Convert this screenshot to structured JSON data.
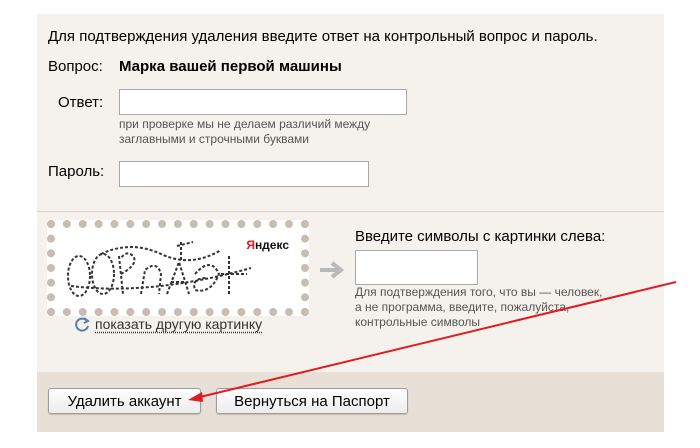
{
  "intro": "Для подтверждения удаления введите ответ на контрольный вопрос и пароль.",
  "question": {
    "label": "Вопрос:",
    "text": "Марка вашей первой машины"
  },
  "answer": {
    "label": "Ответ:",
    "value": "",
    "hint_line1": "при проверке мы не делаем различий между",
    "hint_line2": "заглавными и строчными буквами"
  },
  "password": {
    "label": "Пароль:",
    "value": ""
  },
  "captcha": {
    "brand": "Яндекс",
    "brand_first": "Я",
    "brand_rest": "ндекс",
    "refresh_label": "показать другую картинку",
    "title": "Введите символы с картинки слева:",
    "value": "",
    "hint_line1": "Для подтверждения того, что вы — человек,",
    "hint_line2": "а не программа, введите, пожалуйста,",
    "hint_line3": "контрольные символы"
  },
  "buttons": {
    "delete": "Удалить аккаунт",
    "back": "Вернуться на Паспорт"
  },
  "colors": {
    "panel_bg": "#f5f1ec",
    "footer_bg": "#e8dfd6",
    "annotation_arrow": "#e01b22"
  }
}
